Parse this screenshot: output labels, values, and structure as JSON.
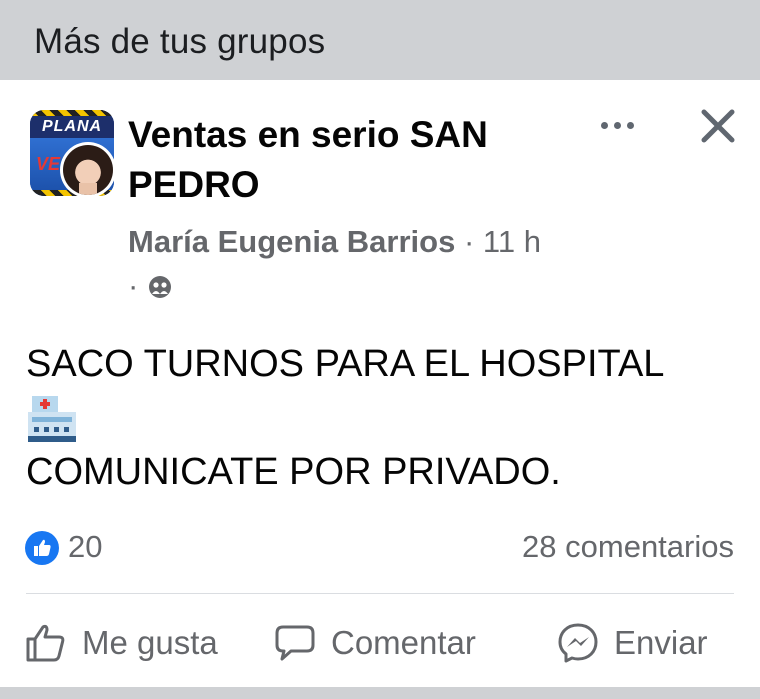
{
  "section": {
    "title": "Más de tus grupos"
  },
  "post": {
    "group_name": "Ventas en serio SAN PEDRO",
    "group_avatar_text": "PLANA",
    "group_avatar_text2": "VE",
    "author": "María Eugenia Barrios",
    "meta_separator": " · ",
    "time": "11 h",
    "privacy_icon": "group-privacy-icon",
    "text_line1": "SACO TURNOS PARA EL HOSPITAL",
    "emoji": "hospital-emoji",
    "text_line2": "COMUNICATE POR PRIVADO.",
    "like_count": "20",
    "comments_count": "28 comentarios"
  },
  "actions": {
    "like_label": "Me gusta",
    "comment_label": "Comentar",
    "send_label": "Enviar"
  },
  "colors": {
    "header_bg": "#cfd1d4",
    "secondary_text": "#65676b",
    "like_blue": "#1877f2"
  }
}
